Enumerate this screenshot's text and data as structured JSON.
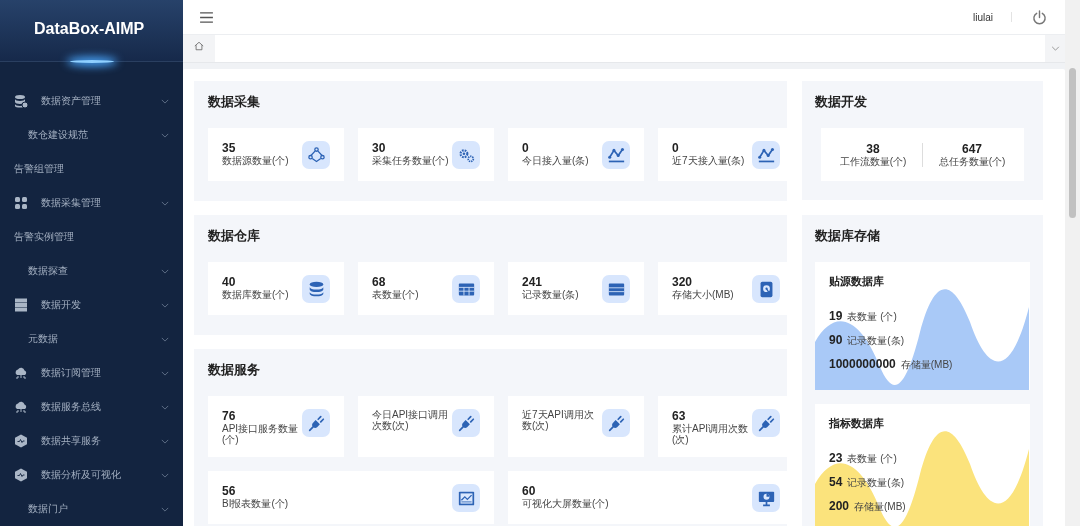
{
  "sidebar": {
    "logo": "DataBox-AIMP",
    "items": [
      {
        "label": "数据资产管理",
        "kind": "menu"
      },
      {
        "label": "数仓建设规范",
        "kind": "submenu"
      },
      {
        "label": "告警组管理",
        "kind": "link"
      },
      {
        "label": "数据采集管理",
        "kind": "menu"
      },
      {
        "label": "告警实例管理",
        "kind": "link"
      },
      {
        "label": "数据探查",
        "kind": "submenu"
      },
      {
        "label": "数据开发",
        "kind": "menu"
      },
      {
        "label": "元数据",
        "kind": "submenu"
      },
      {
        "label": "数据订阅管理",
        "kind": "menu"
      },
      {
        "label": "数据服务总线",
        "kind": "menu"
      },
      {
        "label": "数据共享服务",
        "kind": "menu"
      },
      {
        "label": "数据分析及可视化",
        "kind": "menu"
      },
      {
        "label": "数据门户",
        "kind": "submenu"
      }
    ]
  },
  "header": {
    "user": "liulai"
  },
  "sections": [
    {
      "title": "数据采集",
      "cards": [
        {
          "value": "35",
          "label": "数据源数量(个)"
        },
        {
          "value": "30",
          "label": "采集任务数量(个)"
        },
        {
          "value": "0",
          "label": "今日接入量(条)"
        },
        {
          "value": "0",
          "label": "近7天接入量(条)"
        }
      ]
    },
    {
      "title": "数据仓库",
      "cards": [
        {
          "value": "40",
          "label": "数据库数量(个)"
        },
        {
          "value": "68",
          "label": "表数量(个)"
        },
        {
          "value": "241",
          "label": "记录数量(条)"
        },
        {
          "value": "320",
          "label": "存储大小(MB)"
        }
      ]
    },
    {
      "title": "数据服务",
      "cards": [
        {
          "value": "76",
          "label": "API接口服务数量(个)"
        },
        {
          "label": "今日API接口调用次数(次)"
        },
        {
          "label": "近7天API调用次数(次)"
        },
        {
          "value": "63",
          "label": "累计API调用次数(次)"
        },
        {
          "value": "56",
          "label": "BI报表数量(个)"
        },
        {
          "value": "60",
          "label": "可视化大屏数量(个)"
        }
      ]
    }
  ],
  "dev": {
    "title": "数据开发",
    "stats": [
      {
        "value": "38",
        "label": "工作流数量(个)"
      },
      {
        "value": "647",
        "label": "总任务数量(个)"
      }
    ]
  },
  "storage": {
    "title": "数据库存储",
    "databases": [
      {
        "name": "贴源数据库",
        "color": "#a9c9f7",
        "stats": [
          {
            "value": "19",
            "label": "表数量 (个)"
          },
          {
            "value": "90",
            "label": "记录数量(条)"
          },
          {
            "value": "1000000000",
            "label": "存储量(MB)"
          }
        ]
      },
      {
        "name": "指标数据库",
        "color": "#fbe37c",
        "stats": [
          {
            "value": "23",
            "label": "表数量 (个)"
          },
          {
            "value": "54",
            "label": "记录数量(条)"
          },
          {
            "value": "200",
            "label": "存储量(MB)"
          }
        ]
      }
    ]
  }
}
